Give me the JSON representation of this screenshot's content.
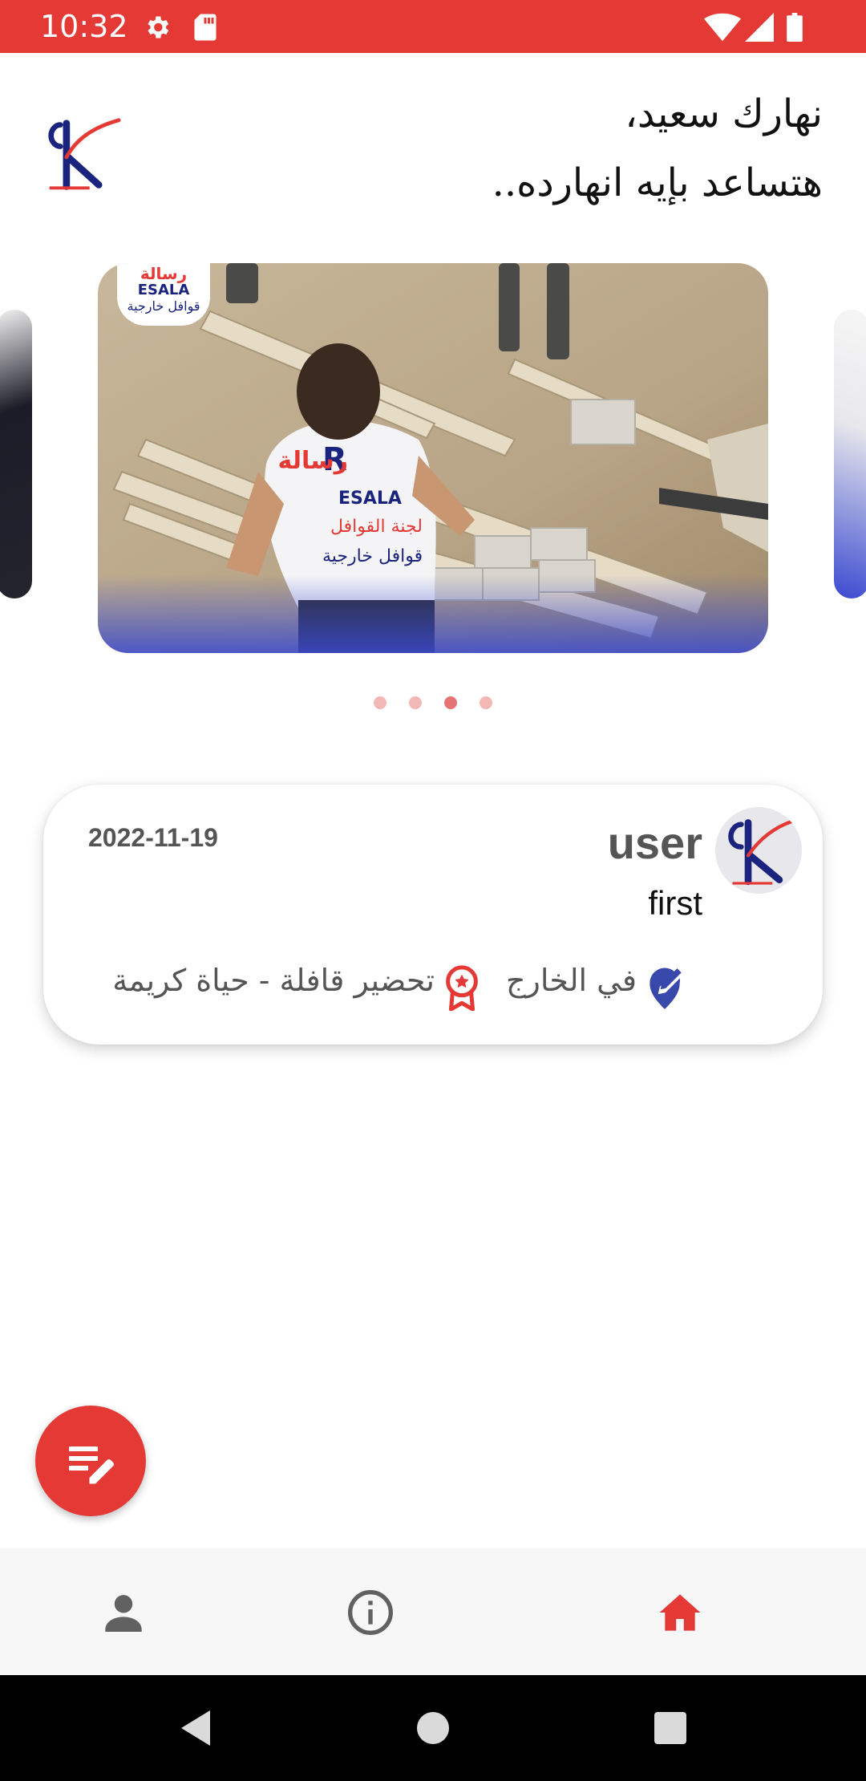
{
  "status_bar": {
    "time": "10:32",
    "icons": [
      "gear-icon",
      "sd-card-icon",
      "wifi-icon",
      "signal-icon",
      "battery-icon"
    ],
    "background": "#e53935"
  },
  "header": {
    "logo_icon": "resala-logo-icon",
    "greeting_line1": "نهارك سعيد،",
    "greeting_line2": "هتساعد بإيه انهارده.."
  },
  "carousel": {
    "slides": 4,
    "active_index": 2,
    "main_slide_badge": {
      "brand_arabic": "رسالة",
      "brand_latin": "ESALA",
      "subtitle": "قوافل خارجية"
    }
  },
  "post_card": {
    "date": "2022-11-19",
    "user_name": "user",
    "user_sub": "first",
    "location_label": "في الخارج",
    "activity_label": "تحضير قافلة - حياة كريمة",
    "location_icon": "location-edit-icon",
    "activity_icon": "award-badge-icon"
  },
  "fab": {
    "icon": "edit-notes-icon",
    "color": "#e53935"
  },
  "bottom_nav": {
    "items": [
      {
        "icon": "person-icon",
        "active": false
      },
      {
        "icon": "info-icon",
        "active": false
      },
      {
        "icon": "home-icon",
        "active": true
      }
    ],
    "active_color": "#e53935",
    "inactive_color": "#616161"
  },
  "system_nav": {
    "icons": [
      "back-icon",
      "home-circle-icon",
      "recents-icon"
    ]
  }
}
